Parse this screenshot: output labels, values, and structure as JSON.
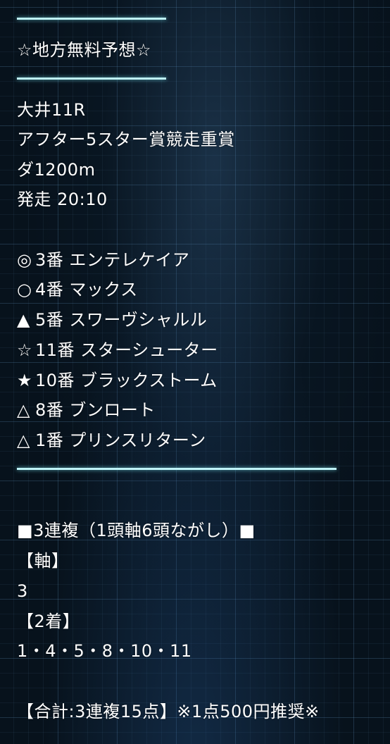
{
  "header": {
    "title": "☆地方無料予想☆"
  },
  "race": {
    "venue_race": "大井11R",
    "name": "アフター5スター賞競走重賞",
    "course": "ダ1200m",
    "start_time": "発走 20:10"
  },
  "picks": [
    {
      "mark": "◎",
      "text": "3番 エンテレケイア"
    },
    {
      "mark": "○",
      "text": "4番 マックス"
    },
    {
      "mark": "▲",
      "text": "5番 スワーヴシャルル"
    },
    {
      "mark": "☆",
      "text": "11番 スターシューター"
    },
    {
      "mark": "★",
      "text": "10番 ブラックストーム"
    },
    {
      "mark": "△",
      "text": "8番 ブンロート"
    },
    {
      "mark": "△",
      "text": "1番 プリンスリターン"
    }
  ],
  "bet": {
    "type_label": "■3連複（1頭軸6頭ながし）■",
    "axis_label": "【軸】",
    "axis_value": "3",
    "second_label": "【2着】",
    "second_value": "1・4・5・8・10・11",
    "total": "【合計:3連複15点】※1点500円推奨※"
  },
  "colors": {
    "rule": "#bff3f7",
    "background": "#07121c",
    "grid": "#6eaadc",
    "text": "#ffffff"
  }
}
